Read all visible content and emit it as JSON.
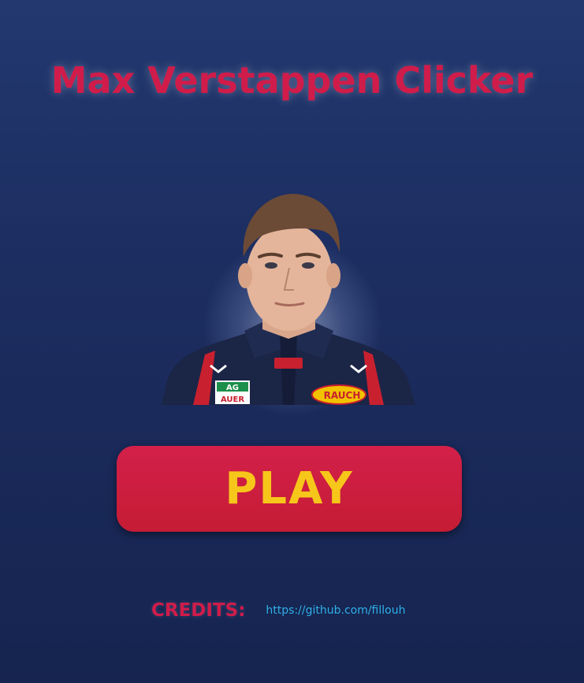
{
  "title": "Max Verstappen Clicker",
  "portrait": {
    "icon": "driver-portrait",
    "badges": {
      "sponsor1": "AG",
      "sponsor1b": "AUER",
      "sponsor2": "RAUCH"
    }
  },
  "play_button": {
    "label": "PLAY"
  },
  "credits": {
    "label": "CREDITS:",
    "link": "https://github.com/fillouh"
  },
  "colors": {
    "background": "#1c2d60",
    "title": "#d01c4a",
    "button": "#cc1e3e",
    "button_text": "#f7c61a",
    "link": "#2fb0e8"
  }
}
